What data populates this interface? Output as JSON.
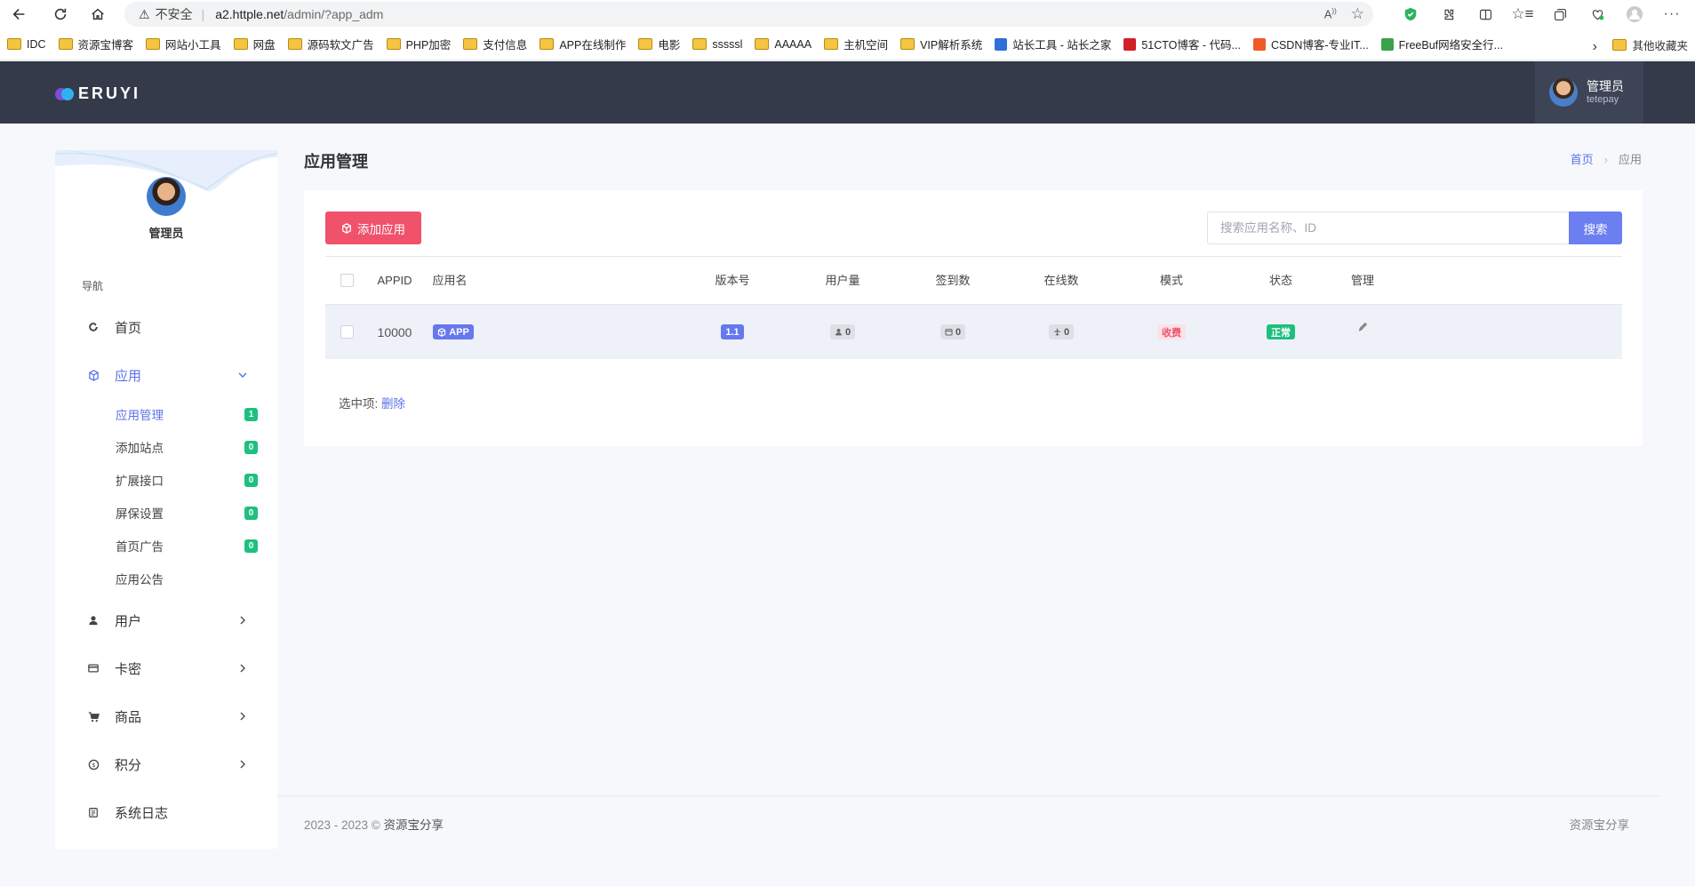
{
  "browser": {
    "insecure_label": "不安全",
    "url_host": "a2.httple.net",
    "url_path": "/admin/?app_adm",
    "bookmarks": [
      {
        "label": "IDC",
        "type": "folder"
      },
      {
        "label": "资源宝博客",
        "type": "folder"
      },
      {
        "label": "网站小工具",
        "type": "folder"
      },
      {
        "label": "网盘",
        "type": "folder"
      },
      {
        "label": "源码软文广告",
        "type": "folder"
      },
      {
        "label": "PHP加密",
        "type": "folder"
      },
      {
        "label": "支付信息",
        "type": "folder"
      },
      {
        "label": "APP在线制作",
        "type": "folder"
      },
      {
        "label": "电影",
        "type": "folder"
      },
      {
        "label": "sssssl",
        "type": "folder"
      },
      {
        "label": "AAAAA",
        "type": "folder"
      },
      {
        "label": "主机空间",
        "type": "folder"
      },
      {
        "label": "VIP解析系统",
        "type": "folder"
      },
      {
        "label": "站长工具 - 站长之家",
        "type": "site",
        "color": "#2f6fd6"
      },
      {
        "label": "51CTO博客 - 代码...",
        "type": "site",
        "color": "#d0202a"
      },
      {
        "label": "CSDN博客-专业IT...",
        "type": "site",
        "color": "#f05a28"
      },
      {
        "label": "FreeBuf网络安全行...",
        "type": "site",
        "color": "#3aa34a"
      }
    ],
    "other_bookmarks": "其他收藏夹"
  },
  "header": {
    "logo_text": "ERUYI",
    "user_name": "管理员",
    "user_account": "tetepay"
  },
  "sidebar": {
    "profile_name": "管理员",
    "nav_title": "导航",
    "items": [
      {
        "label": "首页",
        "icon": "refresh-icon"
      },
      {
        "label": "应用",
        "icon": "cube-icon",
        "expanded": true
      },
      {
        "label": "用户",
        "icon": "user-icon"
      },
      {
        "label": "卡密",
        "icon": "card-icon"
      },
      {
        "label": "商品",
        "icon": "cart-icon"
      },
      {
        "label": "积分",
        "icon": "coin-icon"
      },
      {
        "label": "系统日志",
        "icon": "log-icon"
      }
    ],
    "sub_items": [
      {
        "label": "应用管理",
        "badge": "1"
      },
      {
        "label": "添加站点",
        "badge": "0"
      },
      {
        "label": "扩展接口",
        "badge": "0"
      },
      {
        "label": "屏保设置",
        "badge": "0"
      },
      {
        "label": "首页广告",
        "badge": "0"
      },
      {
        "label": "应用公告",
        "badge": ""
      }
    ]
  },
  "main": {
    "page_title": "应用管理",
    "breadcrumb": {
      "home": "首页",
      "current": "应用"
    },
    "add_button": "添加应用",
    "search": {
      "placeholder": "搜索应用名称、ID",
      "button": "搜索"
    },
    "columns": [
      "APPID",
      "应用名",
      "版本号",
      "用户量",
      "签到数",
      "在线数",
      "模式",
      "状态",
      "管理"
    ],
    "rows": [
      {
        "appid": "10000",
        "name": "APP",
        "version": "1.1",
        "users": "0",
        "checkins": "0",
        "online": "0",
        "mode": "收费",
        "status": "正常"
      }
    ],
    "selected_label": "选中项:",
    "delete_label": "删除"
  },
  "footer": {
    "copyright": "2023 - 2023 ©",
    "brand": "资源宝分享",
    "right": "资源宝分享"
  },
  "colors": {
    "accent": "#5b73e8",
    "header_bg": "#343a4a",
    "danger": "#f0516b",
    "success": "#1dc07f"
  }
}
